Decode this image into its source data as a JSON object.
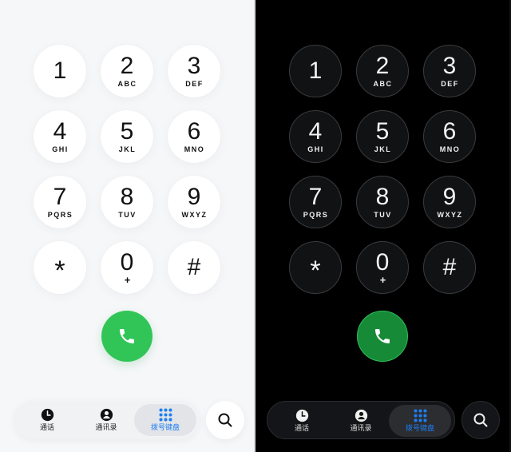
{
  "dialpad": {
    "keys": [
      {
        "digit": "1",
        "letters": ""
      },
      {
        "digit": "2",
        "letters": "ABC"
      },
      {
        "digit": "3",
        "letters": "DEF"
      },
      {
        "digit": "4",
        "letters": "GHI"
      },
      {
        "digit": "5",
        "letters": "JKL"
      },
      {
        "digit": "6",
        "letters": "MNO"
      },
      {
        "digit": "7",
        "letters": "PQRS"
      },
      {
        "digit": "8",
        "letters": "TUV"
      },
      {
        "digit": "9",
        "letters": "WXYZ"
      },
      {
        "digit": "*",
        "letters": ""
      },
      {
        "digit": "0",
        "letters": "+"
      },
      {
        "digit": "#",
        "letters": ""
      }
    ]
  },
  "nav": {
    "recents": "通话",
    "contacts": "通讯录",
    "keypad": "拨号键盘",
    "active": "keypad"
  },
  "colors": {
    "call_light": "#31c558",
    "call_dark": "#168a37",
    "active_tab": "#1e7ef0"
  },
  "icons": {
    "call": "phone-icon",
    "recents": "clock-icon",
    "contacts": "person-icon",
    "keypad": "keypad-grid-icon",
    "search": "search-icon"
  }
}
